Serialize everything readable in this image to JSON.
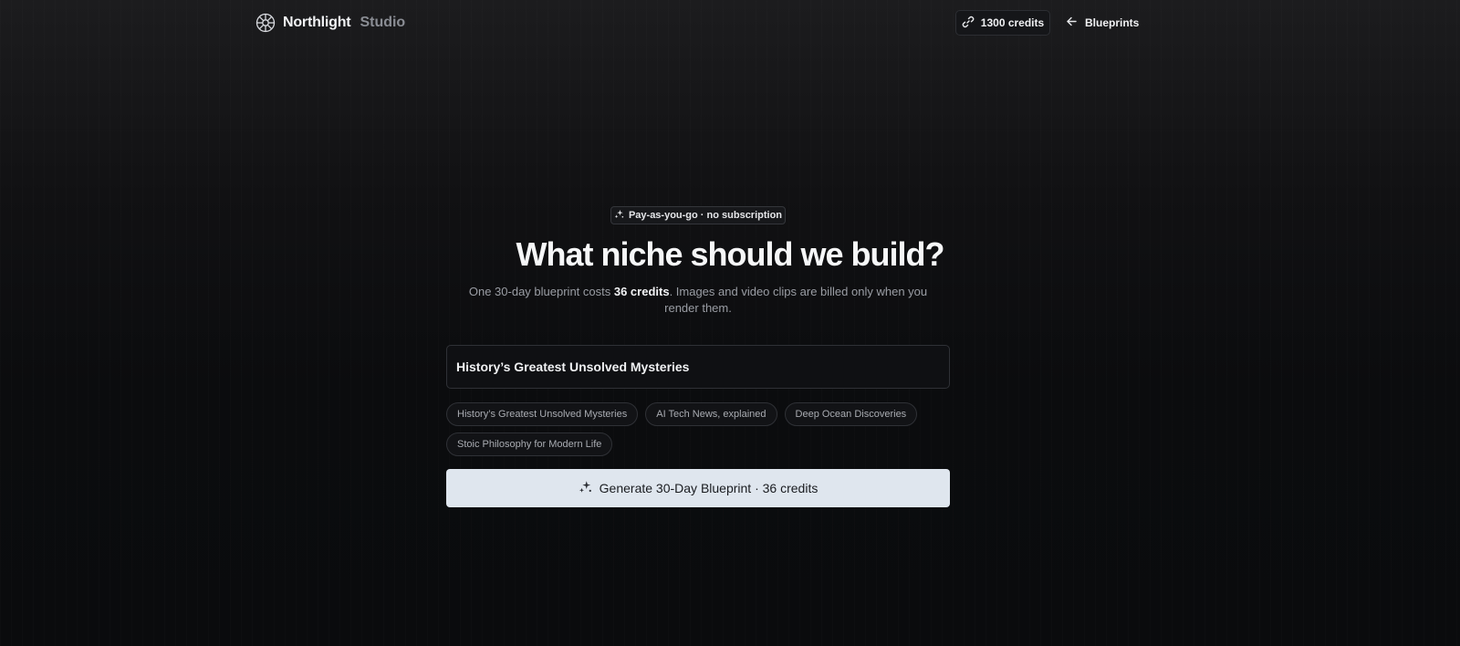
{
  "brand": {
    "name": "Northlight",
    "sub": "Studio",
    "logo_icon": "aperture-icon"
  },
  "header": {
    "credits_label": "1300 credits",
    "credits_icon": "link-icon",
    "back_label": "Blueprints",
    "back_icon": "arrow-left-icon"
  },
  "hero": {
    "badge": "Pay-as-you-go · no subscription",
    "badge_icon": "sparkles-icon",
    "title": "What niche should we build?",
    "subtitle_pre": "One 30-day blueprint costs ",
    "subtitle_bold": "36 credits",
    "subtitle_post": ". Images and video clips are billed only when you render them."
  },
  "niche_input": {
    "value": "History’s Greatest Unsolved Mysteries"
  },
  "suggestions": [
    "History’s Greatest Unsolved Mysteries",
    "AI Tech News, explained",
    "Deep Ocean Discoveries",
    "Stoic Philosophy for Modern Life"
  ],
  "generate_button": {
    "label": "Generate 30-Day Blueprint · 36 credits",
    "icon": "sparkles-icon"
  },
  "colors": {
    "accent_button": "#dfe6ee",
    "background": "#0b0c0e"
  }
}
